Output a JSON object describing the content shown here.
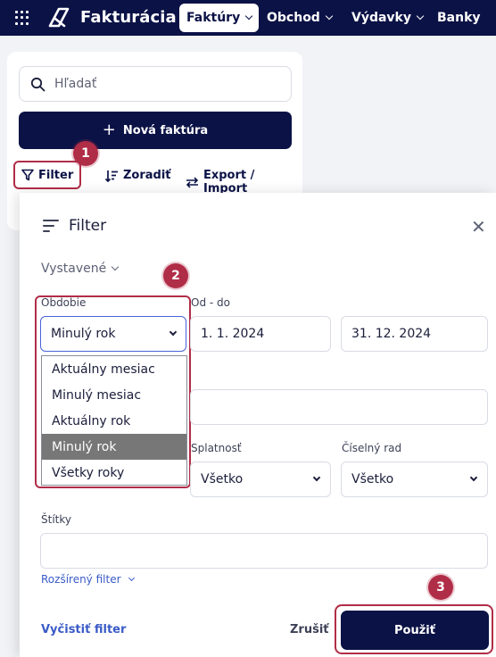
{
  "brand": {
    "name": "Fakturácia"
  },
  "nav": [
    {
      "label": "Faktúry",
      "active": true
    },
    {
      "label": "Obchod",
      "active": false
    },
    {
      "label": "Výdavky",
      "active": false
    },
    {
      "label": "Banky",
      "active": false
    }
  ],
  "sidebar": {
    "search_placeholder": "Hľadať",
    "new_invoice_label": "Nová faktúra",
    "filter_label": "Filter",
    "sort_label": "Zoradiť",
    "export_label": "Export / Import"
  },
  "filter_panel": {
    "title": "Filter",
    "close_symbol": "✕",
    "issued_label": "Vystavené",
    "period_label": "Obdobie",
    "period_value": "Minulý rok",
    "period_options": [
      "Aktuálny mesiac",
      "Minulý mesiac",
      "Aktuálny rok",
      "Minulý rok",
      "Všetky roky"
    ],
    "date_range_label": "Od - do",
    "date_from": "1. 1. 2024",
    "date_to": "31. 12. 2024",
    "due_label": "Splatnosť",
    "due_value": "Všetko",
    "series_label": "Číselný rad",
    "series_value": "Všetko",
    "tags_label": "Štítky",
    "advanced_label": "Rozšírený filter",
    "clear_label": "Vyčistiť filter",
    "cancel_label": "Zrušiť",
    "apply_label": "Použiť"
  },
  "callouts": [
    "1",
    "2",
    "3"
  ],
  "colors": {
    "navy": "#0b1246",
    "accent_red": "#b02d47",
    "link_blue": "#3a5bc7"
  }
}
